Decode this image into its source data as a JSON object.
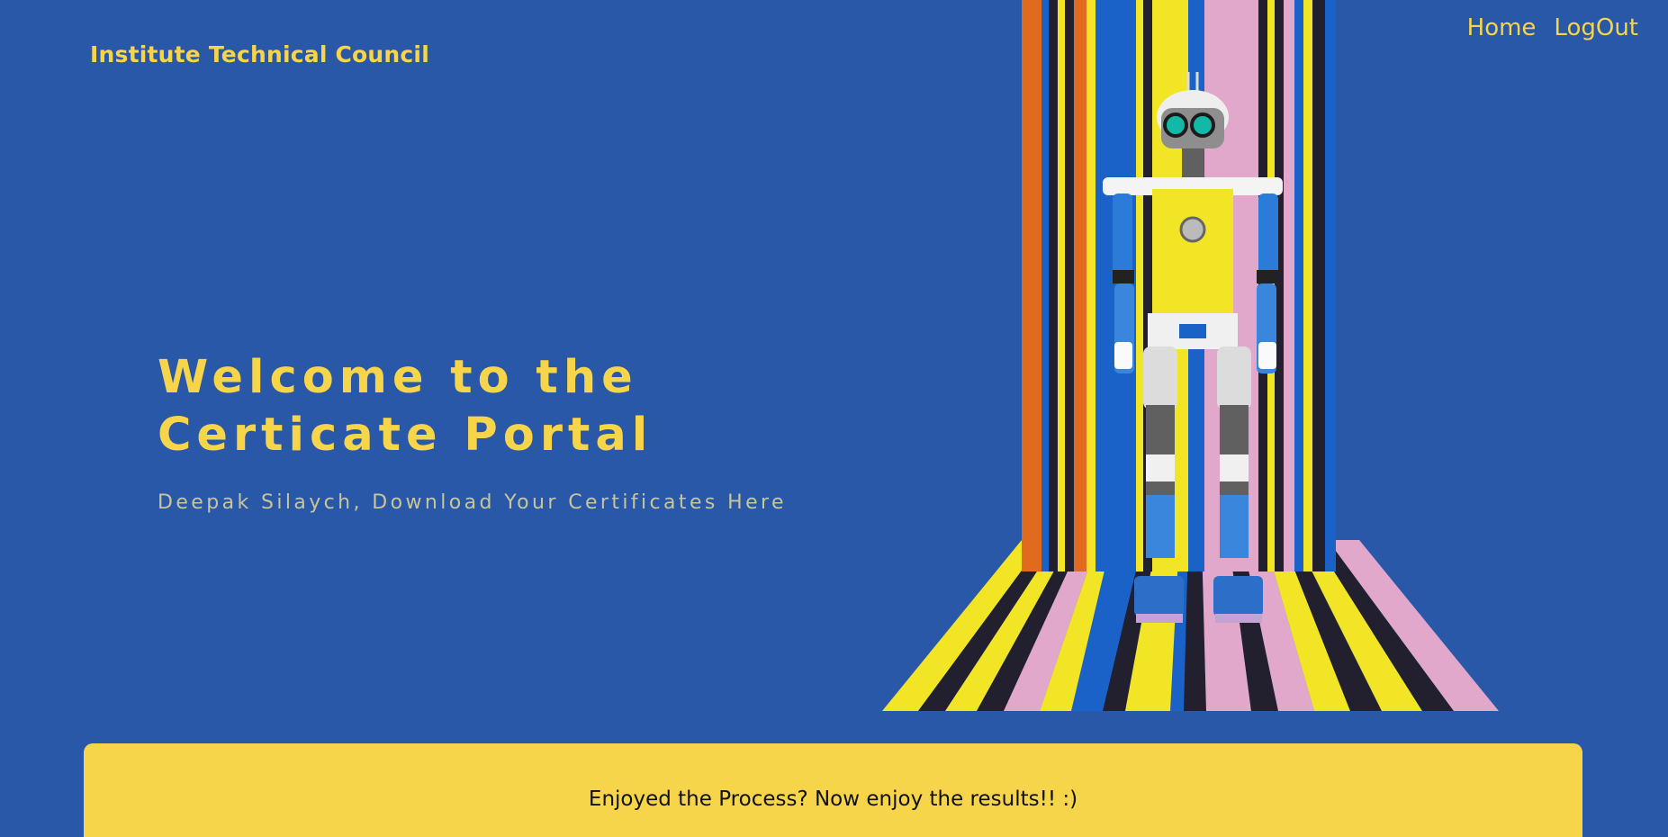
{
  "header": {
    "brand": "Institute Technical Council",
    "nav": [
      {
        "label": "Home"
      },
      {
        "label": "LogOut"
      }
    ]
  },
  "hero": {
    "title_line1": "Welcome to the",
    "title_line2": "Certicate Portal",
    "subtitle": "Deepak Silaych, Download Your Certificates Here"
  },
  "card": {
    "heading": "Enjoyed the Process? Now enjoy the results!! :)",
    "line2": ""
  },
  "colors": {
    "background": "#2958a8",
    "accent_yellow": "#f6d54a"
  },
  "icons": [
    "robot-illustration"
  ]
}
